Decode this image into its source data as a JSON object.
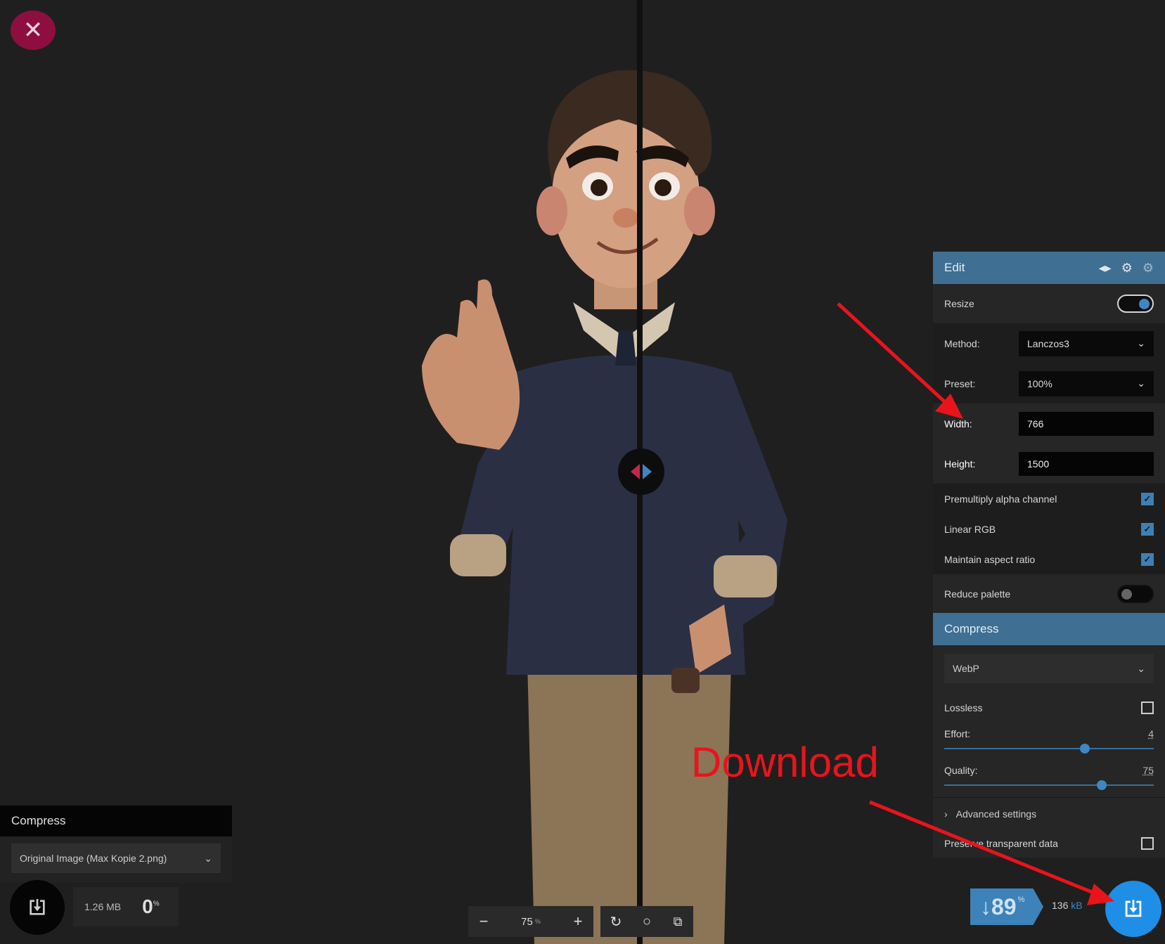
{
  "close": {
    "icon": "close-icon",
    "glyph": "✕"
  },
  "edit_panel": {
    "title": "Edit",
    "icons": [
      "flip-icon",
      "settings-icon",
      "settings-outline-icon"
    ],
    "resize": {
      "label": "Resize",
      "enabled": true
    },
    "method": {
      "label": "Method:",
      "value": "Lanczos3"
    },
    "preset": {
      "label": "Preset:",
      "value": "100%"
    },
    "width": {
      "label": "Width:",
      "value": "766"
    },
    "height": {
      "label": "Height:",
      "value": "1500"
    },
    "premultiply": {
      "label": "Premultiply alpha channel",
      "checked": true
    },
    "linear_rgb": {
      "label": "Linear RGB",
      "checked": true
    },
    "aspect": {
      "label": "Maintain aspect ratio",
      "checked": true
    },
    "reduce_palette": {
      "label": "Reduce palette",
      "enabled": false
    }
  },
  "compress_panel": {
    "title": "Compress",
    "format": "WebP",
    "lossless": {
      "label": "Lossless",
      "checked": false
    },
    "effort": {
      "label": "Effort:",
      "value": "4",
      "fraction": 0.67
    },
    "quality": {
      "label": "Quality:",
      "value": "75",
      "fraction": 0.75
    },
    "advanced": "Advanced settings",
    "preserve": {
      "label": "Preserve transparent data",
      "checked": false
    }
  },
  "output": {
    "percent": "↓89",
    "percent_unit": "%",
    "size": "136",
    "size_unit": "kB"
  },
  "left_panel": {
    "title": "Compress",
    "source": "Original Image (Max Kopie 2.png)",
    "size": "1.26 MB",
    "percent": "0",
    "percent_unit": "%"
  },
  "zoom": {
    "value": "75",
    "unit": "%"
  },
  "annotation": {
    "text": "Download",
    "color": "#e8141c"
  },
  "colors": {
    "accent": "#3f6f93",
    "close": "#8e0f3f",
    "download": "#1e8ee6"
  }
}
